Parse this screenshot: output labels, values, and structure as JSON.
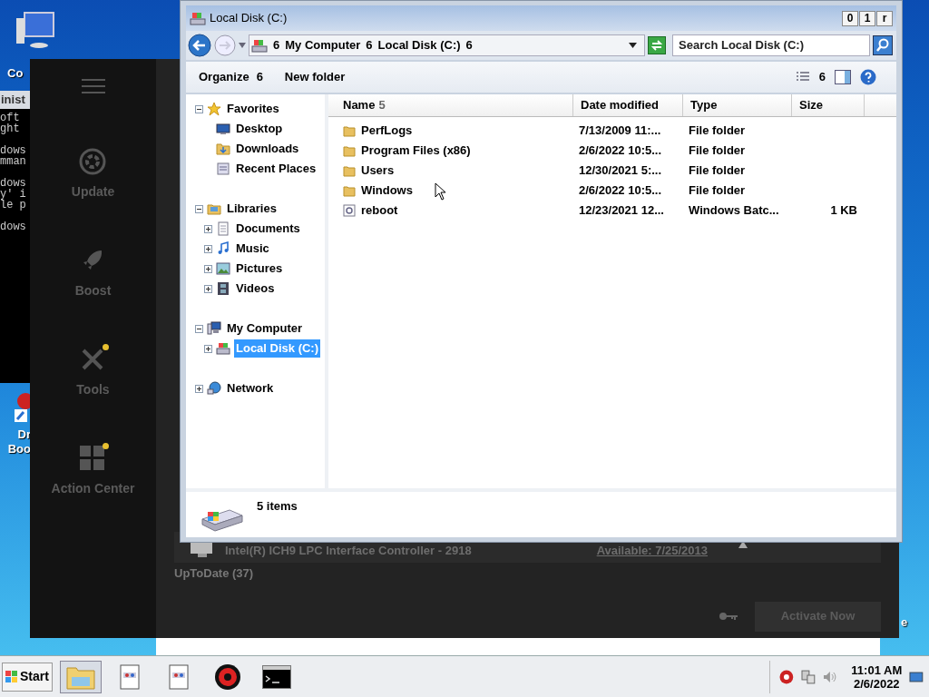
{
  "desktop": {
    "icons": [
      {
        "lines": [
          "Co"
        ]
      },
      {
        "lines": [
          "Dr",
          "Boo"
        ]
      }
    ],
    "edge_text": "e"
  },
  "console": {
    "title": "inist",
    "paragraphs": [
      [
        "oft",
        "ght"
      ],
      [
        "dows",
        "mman"
      ],
      [
        "dows",
        "y' i",
        "le p"
      ],
      [
        "dows"
      ]
    ]
  },
  "booster": {
    "sidebar": [
      {
        "label": "Update",
        "badge": false
      },
      {
        "label": "Boost",
        "badge": false
      },
      {
        "label": "Tools",
        "badge": true
      },
      {
        "label": "Action Center",
        "badge": true
      }
    ],
    "driver_row": {
      "name": "Intel(R) ICH9 LPC Interface Controller - 2918",
      "available": "Available: 7/25/2013"
    },
    "section": "UpToDate (37)",
    "activate": {
      "label": "Activate Now",
      "disabled": true
    }
  },
  "explorer": {
    "title": "Local Disk (C:)",
    "caption_buttons": [
      "0",
      "1",
      "r"
    ],
    "breadcrumb": [
      "6",
      "My Computer",
      "6",
      "Local Disk (C:)",
      "6"
    ],
    "search": {
      "placeholder": "Search Local Disk (C:)"
    },
    "toolbar": {
      "organize": "Organize",
      "organize_arrow": "6",
      "new_folder": "New folder",
      "view_arrow": "6"
    },
    "nav": [
      {
        "label": "Favorites",
        "expanded": true,
        "selected": false,
        "children": [
          {
            "label": "Desktop",
            "selected": false
          },
          {
            "label": "Downloads",
            "selected": false
          },
          {
            "label": "Recent Places",
            "selected": false
          }
        ]
      },
      {
        "label": "Libraries",
        "expanded": true,
        "selected": false,
        "children": [
          {
            "label": "Documents",
            "expanded": false,
            "selected": false
          },
          {
            "label": "Music",
            "expanded": false,
            "selected": false
          },
          {
            "label": "Pictures",
            "expanded": false,
            "selected": false
          },
          {
            "label": "Videos",
            "expanded": false,
            "selected": false
          }
        ]
      },
      {
        "label": "My Computer",
        "expanded": true,
        "selected": false,
        "children": [
          {
            "label": "Local Disk (C:)",
            "expanded": false,
            "selected": true
          }
        ]
      },
      {
        "label": "Network",
        "expanded": false,
        "selected": false
      }
    ],
    "columns": [
      {
        "label": "Name",
        "sort": "5"
      },
      {
        "label": "Date modified"
      },
      {
        "label": "Type"
      },
      {
        "label": "Size"
      }
    ],
    "rows": [
      {
        "kind": "folder",
        "name": "PerfLogs",
        "date": "7/13/2009 11:...",
        "type": "File folder",
        "size": null
      },
      {
        "kind": "folder",
        "name": "Program Files (x86)",
        "date": "2/6/2022 10:5...",
        "type": "File folder",
        "size": null
      },
      {
        "kind": "folder",
        "name": "Users",
        "date": "12/30/2021 5:...",
        "type": "File folder",
        "size": null
      },
      {
        "kind": "folder",
        "name": "Windows",
        "date": "2/6/2022 10:5...",
        "type": "File folder",
        "size": null
      },
      {
        "kind": "batch",
        "name": "reboot",
        "date": "12/23/2021 12...",
        "type": "Windows Batc...",
        "size": "1 KB"
      }
    ],
    "status": "5 items"
  },
  "taskbar": {
    "start": "Start",
    "tasks": [
      {
        "selected": true
      },
      {
        "selected": false
      },
      {
        "selected": false
      },
      {
        "selected": false
      },
      {
        "selected": false
      }
    ],
    "time": "11:01 AM",
    "date": "2/6/2022"
  }
}
